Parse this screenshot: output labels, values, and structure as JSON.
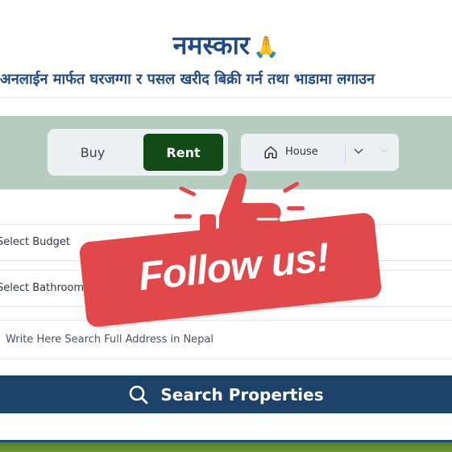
{
  "header": {
    "greeting": "नमस्कार",
    "greeting_emoji": "🙏",
    "subtitle": "अनलाईन मार्फत घरजग्गा र पसल खरीद बिक्री गर्न तथा भाडामा लगाउन"
  },
  "mode_toggle": {
    "buy_label": "Buy",
    "rent_label": "Rent",
    "selected": "Rent"
  },
  "property_type": {
    "icon": "home-icon",
    "value": "House"
  },
  "filters": {
    "budget_placeholder": "Select Budget",
    "bathrooms_placeholder": "Select Bathrooms",
    "address_placeholder": "Write Here Search Full Address in Nepal"
  },
  "search_button": {
    "icon": "search-icon",
    "label": "Search Properties"
  },
  "overlay": {
    "text": "Follow us!",
    "icon": "thumbs-up-icon"
  },
  "colors": {
    "heading_blue": "#1f4a86",
    "band_green": "#b6cdc0",
    "rent_green": "#134b16",
    "search_navy": "#1c426a",
    "follow_red": "#e0484a"
  }
}
